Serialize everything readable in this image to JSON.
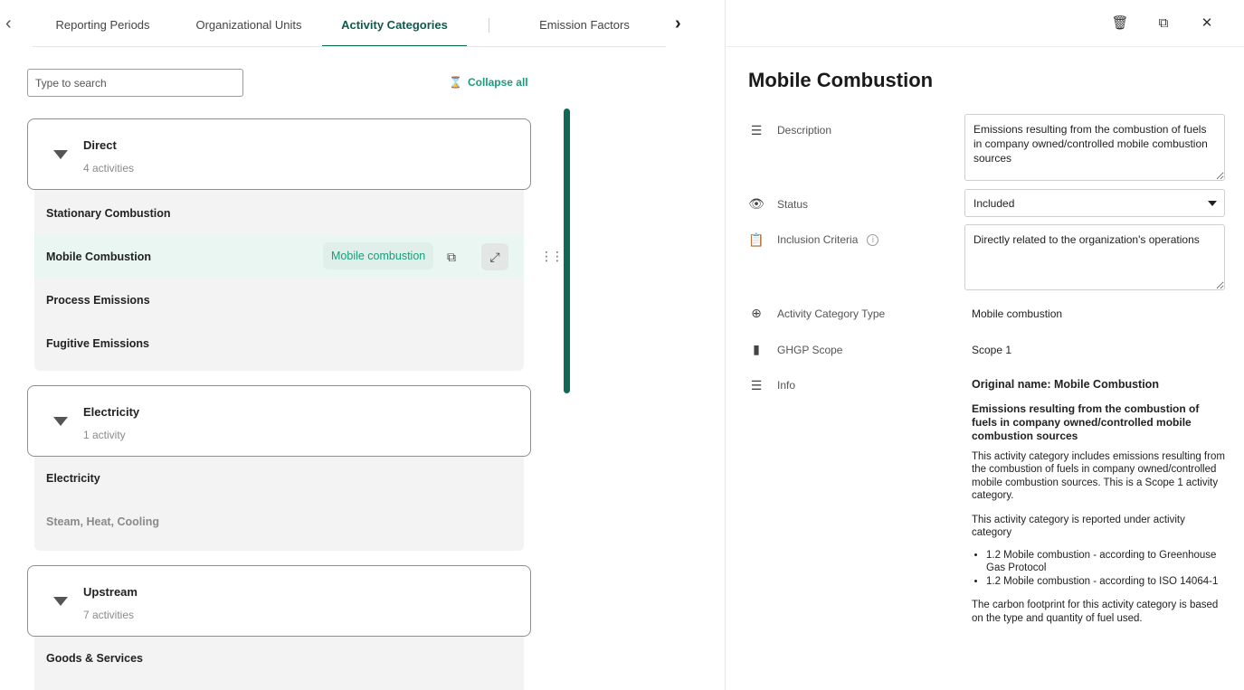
{
  "tabs": {
    "items": [
      {
        "label": "Reporting Periods"
      },
      {
        "label": "Organizational Units"
      },
      {
        "label": "Activity Categories"
      },
      {
        "label": "Emission Factors"
      }
    ]
  },
  "search": {
    "placeholder": "Type to search",
    "value": ""
  },
  "collapse_all": {
    "label": "Collapse all"
  },
  "groups": [
    {
      "name": "Direct",
      "count": "4 activities",
      "items": [
        {
          "label": "Stationary Combustion"
        },
        {
          "label": "Mobile Combustion",
          "chip": "Mobile combustion"
        },
        {
          "label": "Process Emissions"
        },
        {
          "label": "Fugitive Emissions"
        }
      ]
    },
    {
      "name": "Electricity",
      "count": "1 activity",
      "items": [
        {
          "label": "Electricity"
        },
        {
          "label": "Steam, Heat, Cooling"
        }
      ]
    },
    {
      "name": "Upstream",
      "count": "7 activities",
      "items": [
        {
          "label": "Goods & Services"
        }
      ]
    }
  ],
  "detail": {
    "title": "Mobile Combustion",
    "description": {
      "label": "Description",
      "value": "Emissions resulting from the combustion of fuels in company owned/controlled mobile combustion sources"
    },
    "status": {
      "label": "Status",
      "value": "Included"
    },
    "inclusion_criteria": {
      "label": "Inclusion Criteria",
      "value": "Directly related to the organization's operations"
    },
    "activity_category_type": {
      "label": "Activity Category Type",
      "value": "Mobile combustion"
    },
    "ghgp_scope": {
      "label": "GHGP Scope",
      "value": "Scope 1"
    },
    "info": {
      "label": "Info",
      "original_name": "Original name: Mobile Combustion",
      "heading": "Emissions resulting from the combustion of fuels in company owned/controlled mobile combustion sources",
      "paragraph1": "This activity category includes emissions resulting from the combustion of fuels in company owned/controlled mobile combustion sources. This is a Scope 1 activity category.",
      "paragraph2": "This activity category is reported under activity category",
      "bullets": [
        "1.2 Mobile combustion - according to Greenhouse Gas Protocol",
        "1.2 Mobile combustion - according to ISO 14064-1"
      ],
      "paragraph3": "The carbon footprint for this activity category is based on the type and quantity of fuel used."
    }
  }
}
